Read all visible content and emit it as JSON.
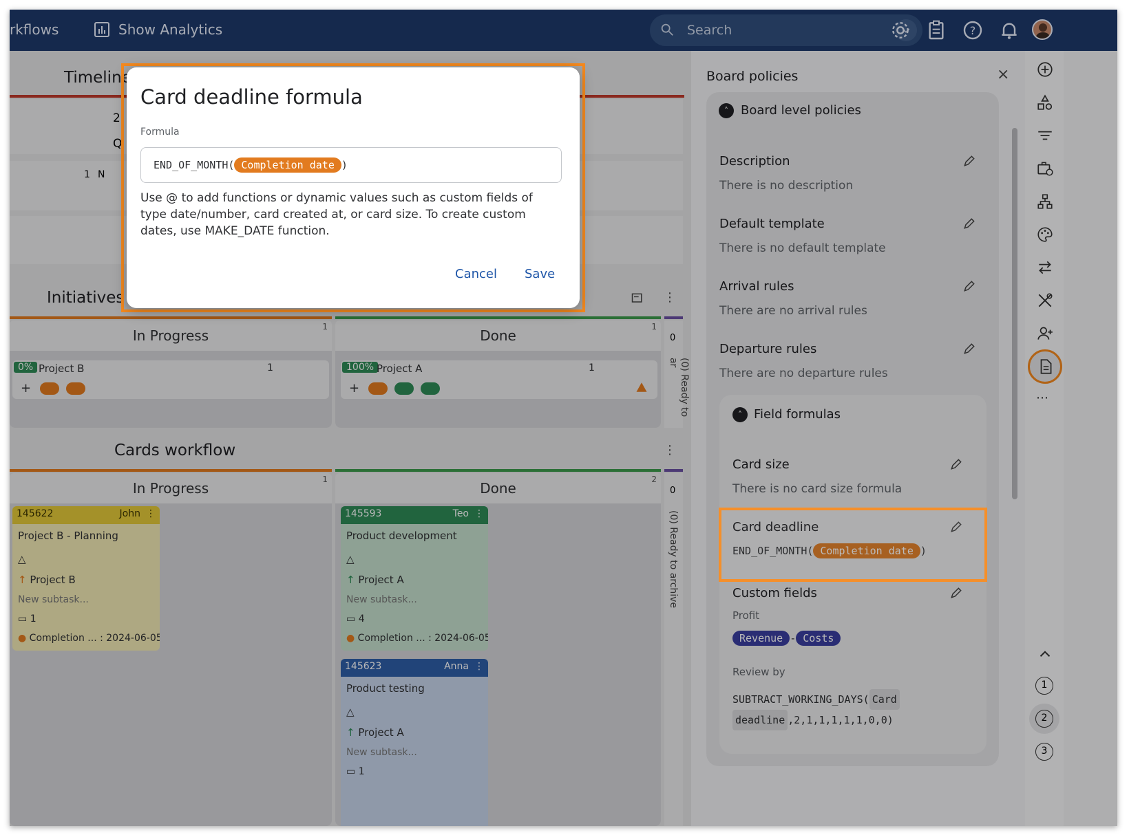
{
  "topbar": {
    "workflows_label": "rkflows",
    "analytics_label": "Show Analytics",
    "search_placeholder": "Search"
  },
  "board": {
    "timeline_title": "Timeline",
    "timeline_partial": [
      "2",
      "Q"
    ],
    "timeline_card_meta": [
      "1",
      "N"
    ],
    "initiatives_title": "Initiatives v",
    "cards_workflow_title": "Cards workflow",
    "initiatives_columns": [
      {
        "label": "In Progress",
        "count": "1"
      },
      {
        "label": "Done",
        "count": "1"
      }
    ],
    "cards_columns": [
      {
        "label": "In Progress",
        "count": "1"
      },
      {
        "label": "Done",
        "count": "2"
      }
    ],
    "archive_count": [
      "0",
      "0"
    ],
    "archive_label_1": "(0) Ready to ar",
    "archive_label_2": "(0) Ready to archive",
    "initiative_cards": [
      {
        "progress": "0%",
        "title": "Project B",
        "count": "1"
      },
      {
        "progress": "100%",
        "title": "Project A",
        "count": "1"
      }
    ],
    "cards": [
      {
        "id": "145622",
        "owner": "John",
        "title": "Project B - Planning",
        "parent": "Project B",
        "subtask": "New subtask...",
        "size": "1",
        "deadline": "Completion ... : 2024-06-05"
      },
      {
        "id": "145593",
        "owner": "Teo",
        "title": "Product development",
        "parent": "Project A",
        "subtask": "New subtask...",
        "size": "4",
        "deadline": "Completion ... : 2024-06-05"
      },
      {
        "id": "145623",
        "owner": "Anna",
        "title": "Product testing",
        "parent": "Project A",
        "subtask": "New subtask...",
        "size": "1"
      }
    ]
  },
  "policies": {
    "title": "Board policies",
    "board_level": "Board level policies",
    "items": [
      {
        "label": "Description",
        "value": "There is no description"
      },
      {
        "label": "Default template",
        "value": "There is no default template"
      },
      {
        "label": "Arrival rules",
        "value": "There are no arrival rules"
      },
      {
        "label": "Departure rules",
        "value": "There are no departure rules"
      }
    ],
    "field_formulas": "Field formulas",
    "card_size_label": "Card size",
    "card_size_value": "There is no card size formula",
    "card_deadline_label": "Card deadline",
    "card_deadline_fn": "END_OF_MONTH(",
    "card_deadline_chip": "Completion date",
    "card_deadline_close": ")",
    "custom_fields_label": "Custom fields",
    "profit_label": "Profit",
    "profit_chip_a": "Revenue",
    "profit_op": "-",
    "profit_chip_b": "Costs",
    "review_label": "Review by",
    "review_fn": "SUBTRACT_WORKING_DAYS(",
    "review_chip_1": "Card",
    "review_chip_2": "deadline",
    "review_args": ",2,1,1,1,1,1,0,0)"
  },
  "rail": {
    "steps": [
      "1",
      "2",
      "3"
    ]
  },
  "modal": {
    "title": "Card deadline formula",
    "field_label": "Formula",
    "formula_fn": "END_OF_MONTH(",
    "formula_chip": "Completion date",
    "formula_close": ")",
    "help": "Use @ to add functions or dynamic values such as custom fields of type date/number, card created at, or card size. To create custom dates, use MAKE_DATE function.",
    "cancel": "Cancel",
    "save": "Save"
  },
  "colors": {
    "topbar": "#1e3a6b",
    "accent_highlight": "#f58a1f",
    "chip_orange": "#e27b1f",
    "chip_purple": "#3b3fa1",
    "link_blue": "#1f56a8",
    "card_yellow": "#e3c93a",
    "card_green": "#2e8b57",
    "card_blue": "#2f5fa8"
  }
}
